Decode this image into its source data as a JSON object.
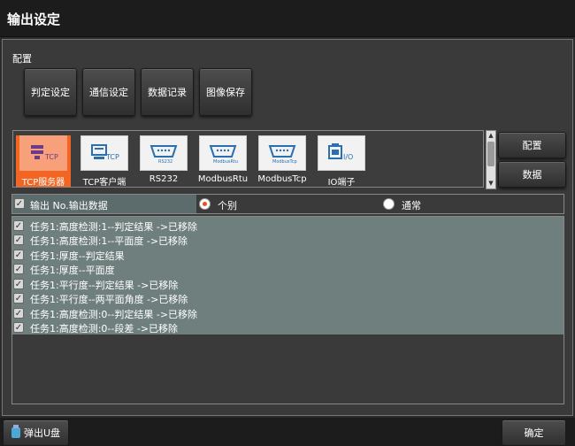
{
  "window": {
    "title": "输出设定"
  },
  "config": {
    "label": "配置",
    "tabs": [
      "判定设定",
      "通信设定",
      "数据记录",
      "图像保存"
    ]
  },
  "protocols": [
    {
      "label": "TCP服务器",
      "icon": "tcp-server-icon",
      "badge": "TCP",
      "selected": true
    },
    {
      "label": "TCP客户端",
      "icon": "tcp-client-icon",
      "badge": "TCP",
      "selected": false
    },
    {
      "label": "RS232",
      "icon": "rs232-icon",
      "badge": "RS232",
      "selected": false
    },
    {
      "label": "ModbusRtu",
      "icon": "modbus-rtu-icon",
      "badge": "ModbusRtu",
      "selected": false
    },
    {
      "label": "ModbusTcp",
      "icon": "modbus-tcp-icon",
      "badge": "ModbusTcp",
      "selected": false
    },
    {
      "label": "IO端子",
      "icon": "io-terminal-icon",
      "badge": "I/O",
      "selected": false
    }
  ],
  "side_buttons": {
    "config": "配置",
    "data": "数据"
  },
  "output_row": {
    "header": "输出 No.输出数据",
    "radio_individual": "个别",
    "radio_normal": "通常",
    "selected": "individual"
  },
  "items": [
    "任务1:高度检测:1--判定结果 ->已移除",
    "任务1:高度检测:1--平面度 ->已移除",
    "任务1:厚度--判定结果",
    "任务1:厚度--平面度",
    "任务1:平行度--判定结果 ->已移除",
    "任务1:平行度--两平面角度 ->已移除",
    "任务1:高度检测:0--判定结果 ->已移除",
    "任务1:高度检测:0--段差 ->已移除"
  ],
  "bottom": {
    "eject": "弹出U盘",
    "ok": "确定"
  },
  "colors": {
    "accent": "#f26522",
    "list_bg": "#6f7f7e"
  }
}
